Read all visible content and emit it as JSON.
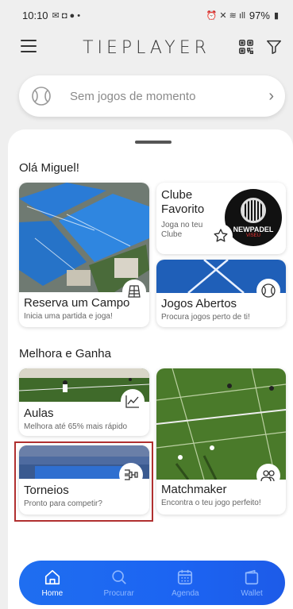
{
  "status_bar": {
    "time": "10:10",
    "battery": "97%"
  },
  "app": {
    "logo": "TIEPLAYER"
  },
  "no_games": {
    "text": "Sem jogos de momento"
  },
  "greeting": "Olá Miguel!",
  "cards_top": {
    "reserva": {
      "title": "Reserva um Campo",
      "subtitle": "Inicia uma partida e joga!"
    },
    "clube": {
      "title_line1": "Clube",
      "title_line2": "Favorito",
      "subtitle_line1": "Joga no teu",
      "subtitle_line2": "Clube",
      "club_logo_text": "NEWPADEL",
      "club_logo_sub": "VISEU"
    },
    "jogos": {
      "title": "Jogos Abertos",
      "subtitle": "Procura jogos perto de ti!"
    }
  },
  "section2_title": "Melhora e Ganha",
  "cards_bottom": {
    "aulas": {
      "title": "Aulas",
      "subtitle": "Melhora até 65% mais rápido"
    },
    "torneios": {
      "title": "Torneios",
      "subtitle": "Pronto para competir?"
    },
    "matchmaker": {
      "title": "Matchmaker",
      "subtitle": "Encontra o teu jogo perfeito!"
    }
  },
  "bottom_nav": {
    "items": [
      {
        "label": "Home",
        "icon": "home-icon",
        "active": true
      },
      {
        "label": "Procurar",
        "icon": "search-icon",
        "active": false
      },
      {
        "label": "Agenda",
        "icon": "calendar-icon",
        "active": false
      },
      {
        "label": "Wallet",
        "icon": "wallet-icon",
        "active": false
      }
    ]
  },
  "colors": {
    "nav_blue": "#1c64f2",
    "court_blue": "#2a7bd6",
    "grass_green": "#4a7a2a",
    "highlight": "#b03030"
  }
}
